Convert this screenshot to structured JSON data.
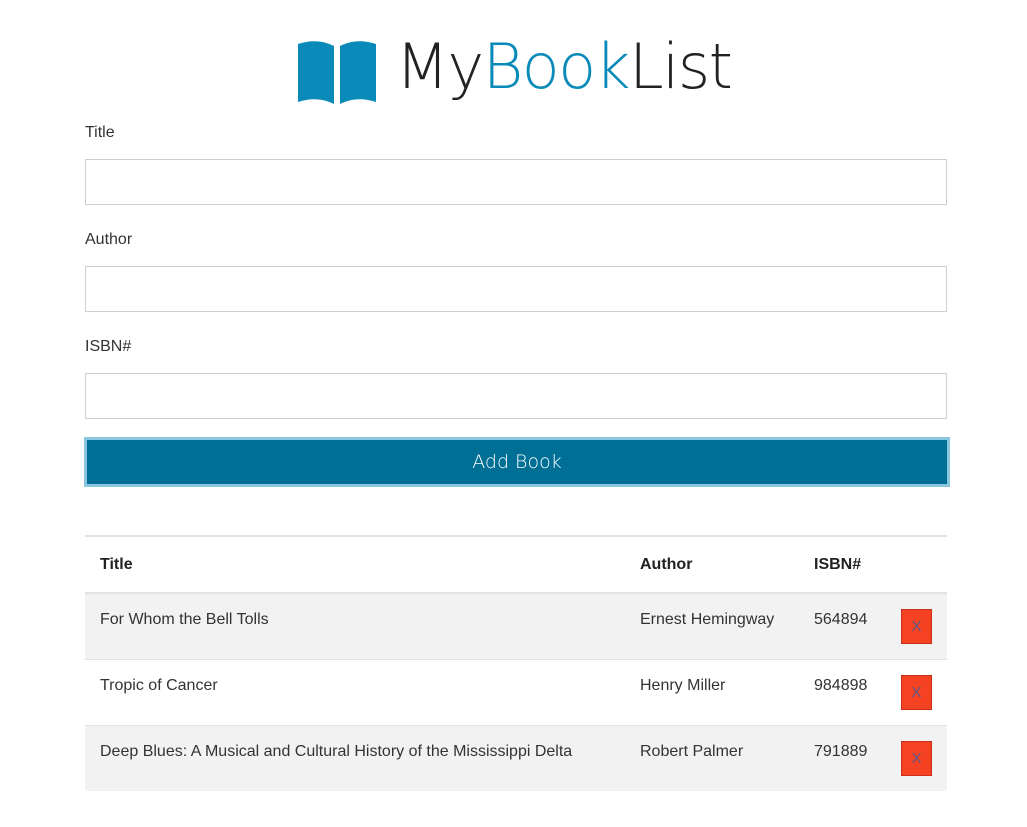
{
  "brand": {
    "name_part1": "My",
    "name_part2": "Book",
    "name_part3": "List",
    "logo_icon": "open-book-icon",
    "accent_color": "#0a8ab8"
  },
  "form": {
    "title_label": "Title",
    "title_value": "",
    "author_label": "Author",
    "author_value": "",
    "isbn_label": "ISBN#",
    "isbn_value": "",
    "submit_label": "Add Book",
    "submit_color": "#006f96"
  },
  "table": {
    "headers": {
      "title": "Title",
      "author": "Author",
      "isbn": "ISBN#"
    },
    "rows": [
      {
        "title": "For Whom the Bell Tolls",
        "author": "Ernest Hemingway",
        "isbn": "564894",
        "delete_label": "X"
      },
      {
        "title": "Tropic of Cancer",
        "author": "Henry Miller",
        "isbn": "984898",
        "delete_label": "X"
      },
      {
        "title": "Deep Blues: A Musical and Cultural History of the Mississippi Delta",
        "author": "Robert Palmer",
        "isbn": "791889",
        "delete_label": "X"
      }
    ],
    "delete_color": "#f44223"
  }
}
